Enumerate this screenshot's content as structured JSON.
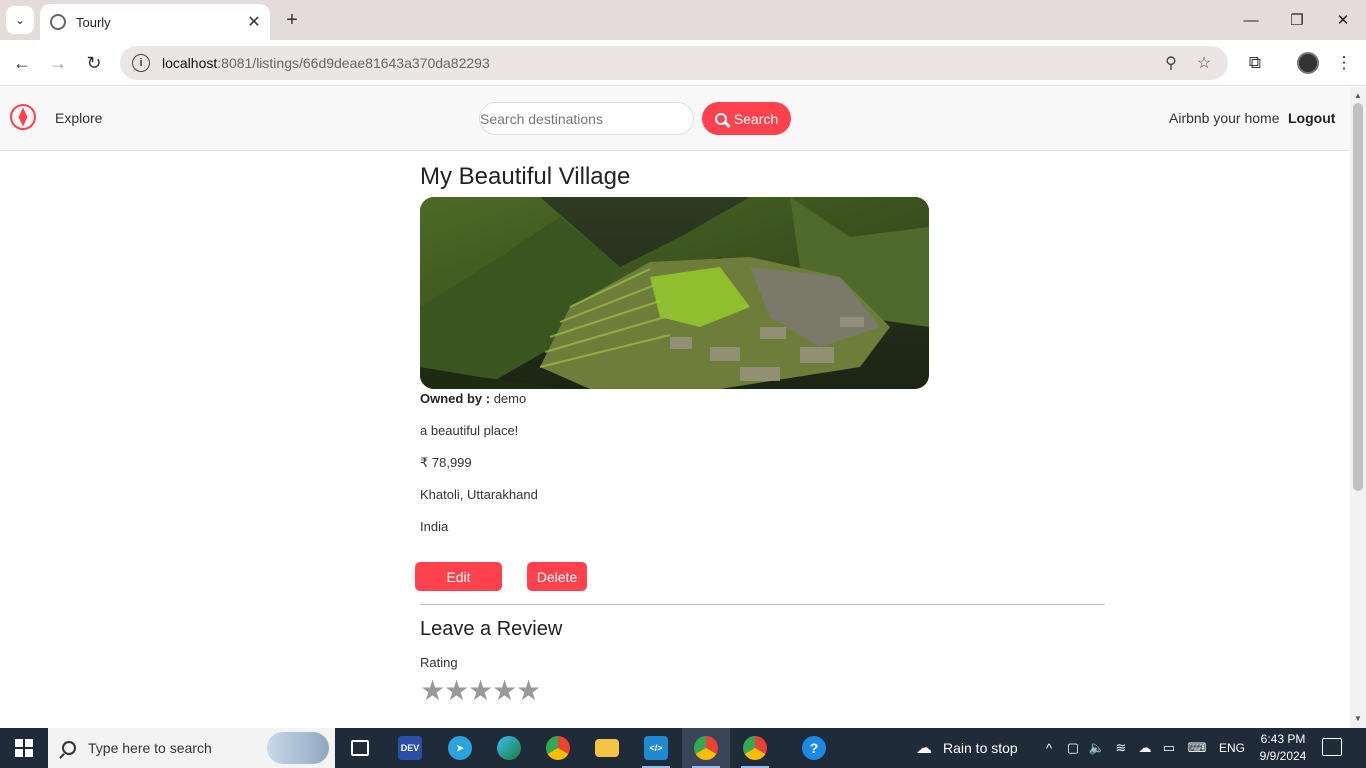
{
  "browser": {
    "tab_title": "Tourly",
    "url_host": "localhost",
    "url_path": ":8081/listings/66d9deae81643a370da82293"
  },
  "navbar": {
    "explore_label": "Explore",
    "search_placeholder": "Search destinations",
    "search_button_label": "Search",
    "host_link_label": "Airbnb your home",
    "logout_label": "Logout"
  },
  "listing": {
    "title": "My Beautiful Village",
    "owner_label": "Owned by :",
    "owner_name": "demo",
    "description": "a beautiful place!",
    "price": "₹ 78,999",
    "location": "Khatoli, Uttarakhand",
    "country": "India",
    "edit_label": "Edit",
    "delete_label": "Delete"
  },
  "review": {
    "heading": "Leave a Review",
    "rating_label": "Rating",
    "rating_value": 0,
    "rating_max": 5
  },
  "taskbar": {
    "search_placeholder": "Type here to search",
    "weather_text": "Rain to stop",
    "language": "ENG",
    "time": "6:43 PM",
    "date": "9/9/2024",
    "apps": [
      "task-view",
      "dev",
      "telegram",
      "edge",
      "chrome",
      "file-explorer",
      "vscode",
      "chrome-profile-1",
      "chrome-profile-2",
      "help"
    ]
  },
  "colors": {
    "brand": "#fe424d",
    "taskbar": "#202b3a"
  }
}
